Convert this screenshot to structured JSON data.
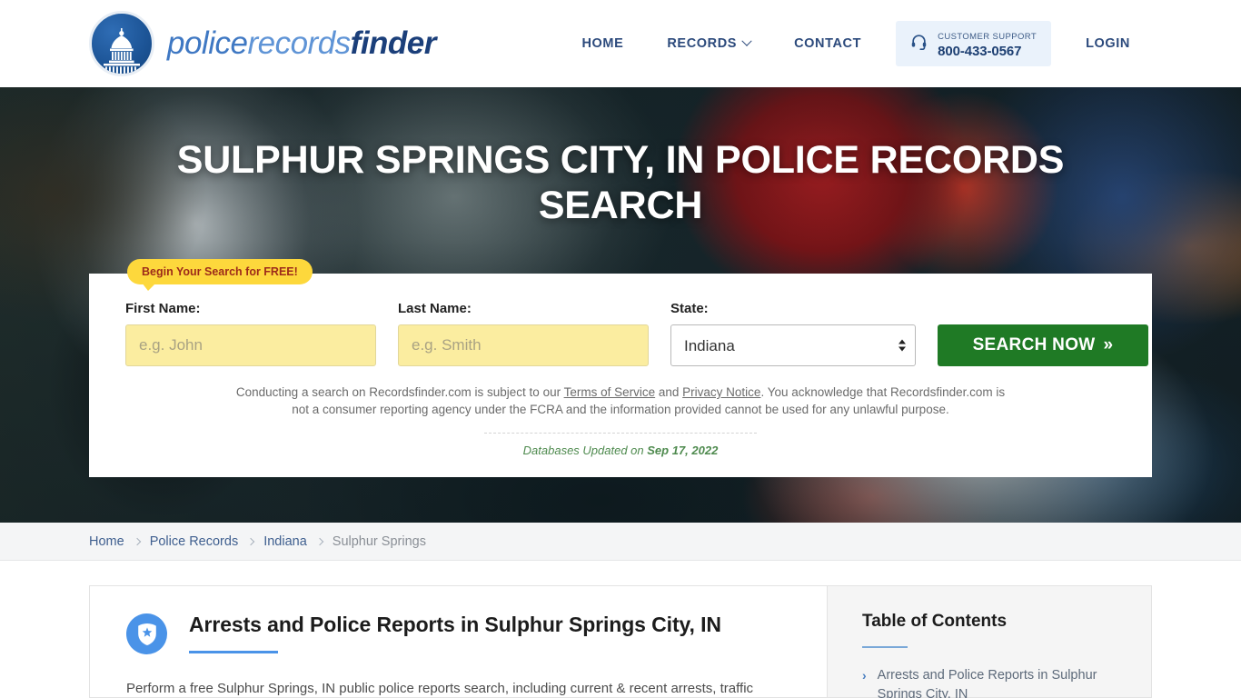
{
  "header": {
    "logo": {
      "icon": "capitol-dome-icon",
      "text_part1": "police",
      "text_part2": "records",
      "text_part3": "finder"
    },
    "nav": [
      {
        "label": "HOME",
        "name": "nav-home",
        "has_chevron": false
      },
      {
        "label": "RECORDS",
        "name": "nav-records",
        "has_chevron": true
      },
      {
        "label": "CONTACT",
        "name": "nav-contact",
        "has_chevron": false
      }
    ],
    "support": {
      "icon": "headset-icon",
      "label": "CUSTOMER SUPPORT",
      "phone": "800-433-0567",
      "bg_color": "#eaf2fb"
    },
    "login_label": "LOGIN"
  },
  "hero": {
    "title": "SULPHUR SPRINGS CITY, IN POLICE RECORDS SEARCH",
    "background": "blurred-police-cars-with-emergency-lights"
  },
  "search_form": {
    "badge": "Begin Your Search for FREE!",
    "badge_bg": "#fdd83c",
    "badge_color": "#9d2b1a",
    "first_name": {
      "label": "First Name:",
      "placeholder": "e.g. John",
      "value": ""
    },
    "last_name": {
      "label": "Last Name:",
      "placeholder": "e.g. Smith",
      "value": ""
    },
    "state": {
      "label": "State:",
      "selected": "Indiana"
    },
    "submit_label": "SEARCH NOW",
    "submit_chevrons": "»",
    "submit_color": "#1f7a25",
    "disclaimer_1": "Conducting a search on Recordsfinder.com is subject to our ",
    "disclaimer_link_1": "Terms of Service",
    "disclaimer_2": " and ",
    "disclaimer_link_2": "Privacy Notice",
    "disclaimer_3": ". You acknowledge that Recordsfinder.com is not a consumer reporting agency under the FCRA and the information provided cannot be used for any unlawful purpose.",
    "updated_prefix": "Databases Updated on ",
    "updated_date": "Sep 17, 2022"
  },
  "breadcrumb": {
    "items": [
      {
        "label": "Home",
        "name": "breadcrumb-home"
      },
      {
        "label": "Police Records",
        "name": "breadcrumb-police-records"
      },
      {
        "label": "Indiana",
        "name": "breadcrumb-indiana"
      },
      {
        "label": "Sulphur Springs",
        "name": "breadcrumb-sulphur-springs"
      }
    ]
  },
  "main": {
    "section": {
      "icon": "police-badge-icon",
      "title": "Arrests and Police Reports in Sulphur Springs City, IN",
      "paragraph": "Perform a free Sulphur Springs, IN public police reports search, including current & recent arrests, traffic"
    },
    "toc": {
      "title": "Table of Contents",
      "items": [
        {
          "label": "Arrests and Police Reports in Sulphur Springs City, IN"
        }
      ],
      "arrow_glyph": "›"
    }
  }
}
